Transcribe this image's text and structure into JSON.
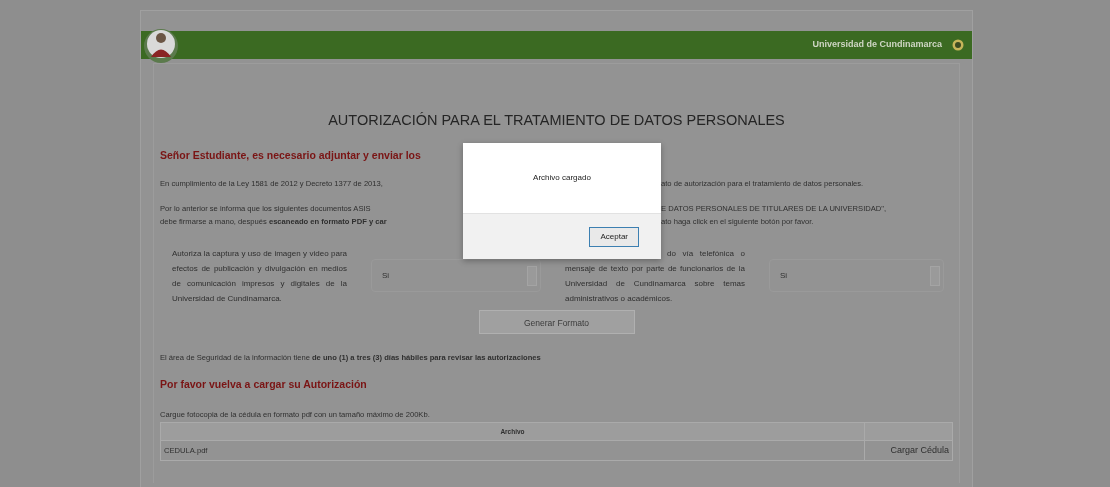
{
  "header": {
    "brand": "Universidad de Cundinamarca"
  },
  "title": "AUTORIZACIÓN PARA EL TRATAMIENTO DE DATOS PERSONALES",
  "intro_lines": [
    {
      "kind": "heading",
      "left": "Señor Estudiante, es necesario adjuntar y enviar los"
    },
    {
      "kind": "text",
      "left": "En cumplimiento de la Ley 1581 de 2012 y Decreto 1377 de 2013,",
      "right": "ato de autorización para el tratamiento de datos personales."
    },
    {
      "kind": "text",
      "left": "Por lo anterior se informa que los siguientes documentos ASIS",
      "right": "E DATOS PERSONALES DE TITULARES DE LA UNIVERSIDAD\","
    },
    {
      "kind": "text_tight",
      "left": "debe firmarse a mano, después **escaneado en formato PDF y car**",
      "right": "ato haga click en el siguiente botón por favor."
    }
  ],
  "consents": [
    {
      "label": "Autoriza la captura y uso de imagen y video para efectos de publicación y divulgación en medios de comunicación impresos y digitales de la Universidad de Cundinamarca.",
      "value": "Si"
    },
    {
      "label": "do vía telefónica o mensaje de texto por parte de funcionarios de la Universidad de Cundinamarca sobre temas administrativos o académicos.",
      "value": "Si"
    }
  ],
  "generate_button": "Generar Formato",
  "review_note": "El área de Seguridad de la información tiene **de uno (1) a tres (3) días hábiles para revisar las autorizaciones**",
  "upload": {
    "heading": "Por favor vuelva a cargar su Autorización",
    "instruction": "Cargue fotocopia de la cédula en formato pdf con un tamaño máximo de 200Kb.",
    "columns": [
      "Archivo"
    ],
    "rows": [
      {
        "file": "CEDULA.pdf",
        "action": "Cargar Cédula"
      }
    ]
  },
  "dialog": {
    "message": "Archivo cargado",
    "button": "Aceptar"
  }
}
